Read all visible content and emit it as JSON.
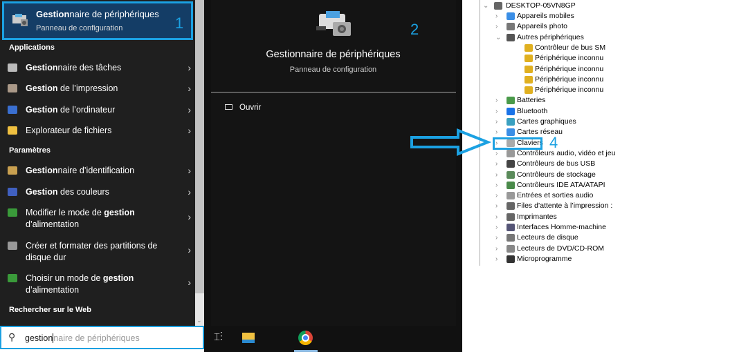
{
  "start": {
    "best_match": {
      "title_bold": "Gestion",
      "title_rest": "naire de périphériques",
      "subtitle": "Panneau de configuration",
      "step": "1"
    },
    "sections": {
      "apps": "Applications",
      "settings": "Paramètres",
      "web": "Rechercher sur le Web"
    },
    "apps": [
      {
        "bold": "Gestion",
        "rest": "naire des tâches",
        "icon": "task-manager-icon"
      },
      {
        "bold": "Gestion",
        "rest": " de l’impression",
        "icon": "print-management-icon"
      },
      {
        "bold": "Gestion",
        "rest": " de l’ordinateur",
        "icon": "computer-management-icon"
      },
      {
        "bold": "",
        "rest": "Explorateur de fichiers",
        "icon": "folder-icon"
      }
    ],
    "settings": [
      {
        "pre": "",
        "bold": "Gestion",
        "rest": "naire d’identification",
        "line2": ""
      },
      {
        "pre": "",
        "bold": "Gestion",
        "rest": " des couleurs",
        "line2": ""
      },
      {
        "pre": "Modifier le mode de ",
        "bold": "gestion",
        "rest": "",
        "line2": "d’alimentation"
      },
      {
        "pre": "Créer et formater des partitions de",
        "bold": "",
        "rest": "",
        "line2": "disque dur"
      },
      {
        "pre": "Choisir un mode de ",
        "bold": "gestion",
        "rest": "",
        "line2": "d’alimentation"
      }
    ],
    "search": {
      "typed": "gestion",
      "suggest": "naire de périphériques"
    }
  },
  "preview": {
    "title": "Gestionnaire de périphériques",
    "subtitle": "Panneau de configuration",
    "open": "Ouvrir",
    "step": "2"
  },
  "devmgr": {
    "root": "DESKTOP-05VN8GP",
    "items": [
      {
        "label": "Appareils mobiles",
        "level": 1,
        "exp": ">",
        "color": "#3a8ee6"
      },
      {
        "label": "Appareils photo",
        "level": 1,
        "exp": ">",
        "color": "#777"
      },
      {
        "label": "Autres périphériques",
        "level": 1,
        "exp": "v",
        "color": "#555"
      },
      {
        "label": "Contrôleur de bus SM",
        "level": 2,
        "exp": "",
        "color": "#e0b020"
      },
      {
        "label": "Périphérique inconnu",
        "level": 2,
        "exp": "",
        "color": "#e0b020"
      },
      {
        "label": "Périphérique inconnu",
        "level": 2,
        "exp": "",
        "color": "#e0b020"
      },
      {
        "label": "Périphérique inconnu",
        "level": 2,
        "exp": "",
        "color": "#e0b020"
      },
      {
        "label": "Périphérique inconnu",
        "level": 2,
        "exp": "",
        "color": "#e0b020"
      },
      {
        "label": "Batteries",
        "level": 1,
        "exp": ">",
        "color": "#4a9a4a"
      },
      {
        "label": "Bluetooth",
        "level": 1,
        "exp": ">",
        "color": "#1a73e8"
      },
      {
        "label": "Cartes graphiques",
        "level": 1,
        "exp": ">",
        "color": "#3aa0c0"
      },
      {
        "label": "Cartes réseau",
        "level": 1,
        "exp": ">",
        "color": "#3a8ee6"
      },
      {
        "label": "Claviers",
        "level": 1,
        "exp": ">",
        "color": "#aaa"
      },
      {
        "label": "Contrôleurs audio, vidéo et jeu",
        "level": 1,
        "exp": ">",
        "color": "#999"
      },
      {
        "label": "Contrôleurs de bus USB",
        "level": 1,
        "exp": ">",
        "color": "#444"
      },
      {
        "label": "Contrôleurs de stockage",
        "level": 1,
        "exp": ">",
        "color": "#5a8a5a"
      },
      {
        "label": "Contrôleurs IDE ATA/ATAPI",
        "level": 1,
        "exp": ">",
        "color": "#4a8a4a"
      },
      {
        "label": "Entrées et sorties audio",
        "level": 1,
        "exp": ">",
        "color": "#999"
      },
      {
        "label": "Files d’attente à l’impression :",
        "level": 1,
        "exp": ">",
        "color": "#666"
      },
      {
        "label": "Imprimantes",
        "level": 1,
        "exp": ">",
        "color": "#666"
      },
      {
        "label": "Interfaces Homme-machine",
        "level": 1,
        "exp": ">",
        "color": "#557"
      },
      {
        "label": "Lecteurs de disque",
        "level": 1,
        "exp": ">",
        "color": "#777"
      },
      {
        "label": "Lecteurs de DVD/CD-ROM",
        "level": 1,
        "exp": ">",
        "color": "#888"
      },
      {
        "label": "Microprogramme",
        "level": 1,
        "exp": ">",
        "color": "#333"
      }
    ],
    "step": "4"
  },
  "colors": {
    "accent": "#1ba1e2",
    "selected": "#143d66"
  }
}
